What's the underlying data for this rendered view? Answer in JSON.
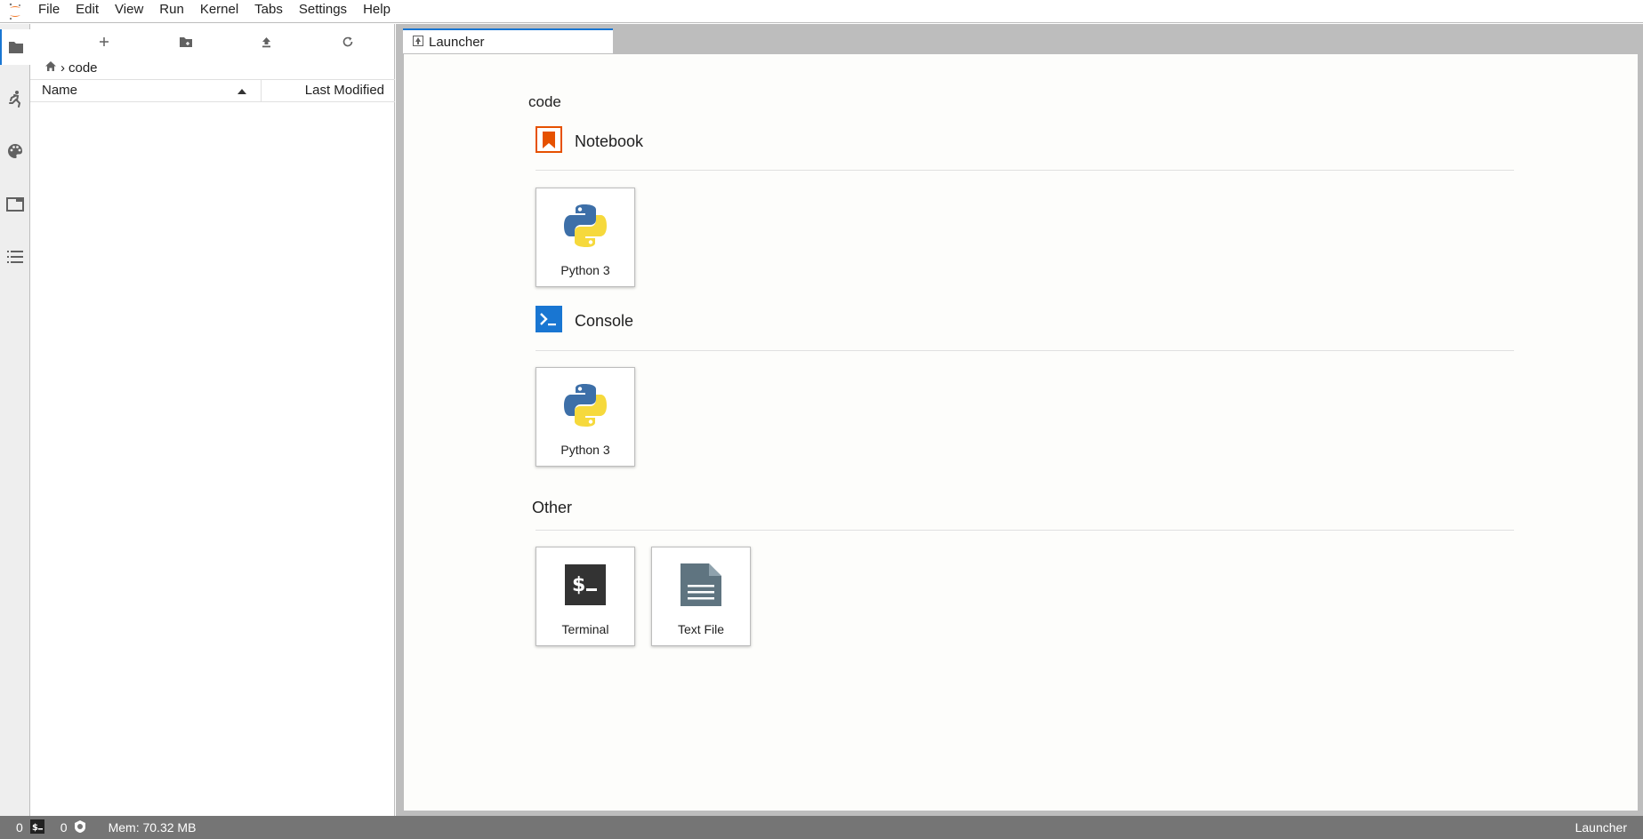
{
  "menubar": {
    "items": [
      "File",
      "Edit",
      "View",
      "Run",
      "Kernel",
      "Tabs",
      "Settings",
      "Help"
    ]
  },
  "activity_bar": {
    "icons": [
      "folder-icon",
      "running-icon",
      "palette-icon",
      "tabs-icon",
      "toc-icon"
    ]
  },
  "file_browser": {
    "toolbar": [
      "new-launcher-icon",
      "new-folder-icon",
      "upload-icon",
      "refresh-icon"
    ],
    "breadcrumb": {
      "home_icon": "home-icon",
      "separator": "›",
      "current": "code"
    },
    "columns": {
      "name": "Name",
      "last_modified": "Last Modified"
    },
    "items": []
  },
  "tabs": [
    {
      "label": "Launcher",
      "icon": "launcher-icon",
      "active": true
    }
  ],
  "launcher": {
    "cwd": "code",
    "sections": {
      "notebook": {
        "title": "Notebook",
        "cards": [
          {
            "label": "Python 3"
          }
        ]
      },
      "console": {
        "title": "Console",
        "cards": [
          {
            "label": "Python 3"
          }
        ]
      },
      "other": {
        "title": "Other",
        "cards": [
          {
            "label": "Terminal"
          },
          {
            "label": "Text File"
          }
        ]
      }
    }
  },
  "statusbar": {
    "kernels_count": "0",
    "terminals_count": "0",
    "memory": "Mem: 70.32 MB",
    "right_label": "Launcher"
  },
  "colors": {
    "notebook_accent": "#e65100",
    "console_accent": "#1976d2",
    "statusbar_bg": "#757575",
    "python_blue": "#3d6fa8",
    "python_yellow": "#f6d93c",
    "terminal_bg": "#333333",
    "textfile_gray": "#5f7480"
  }
}
